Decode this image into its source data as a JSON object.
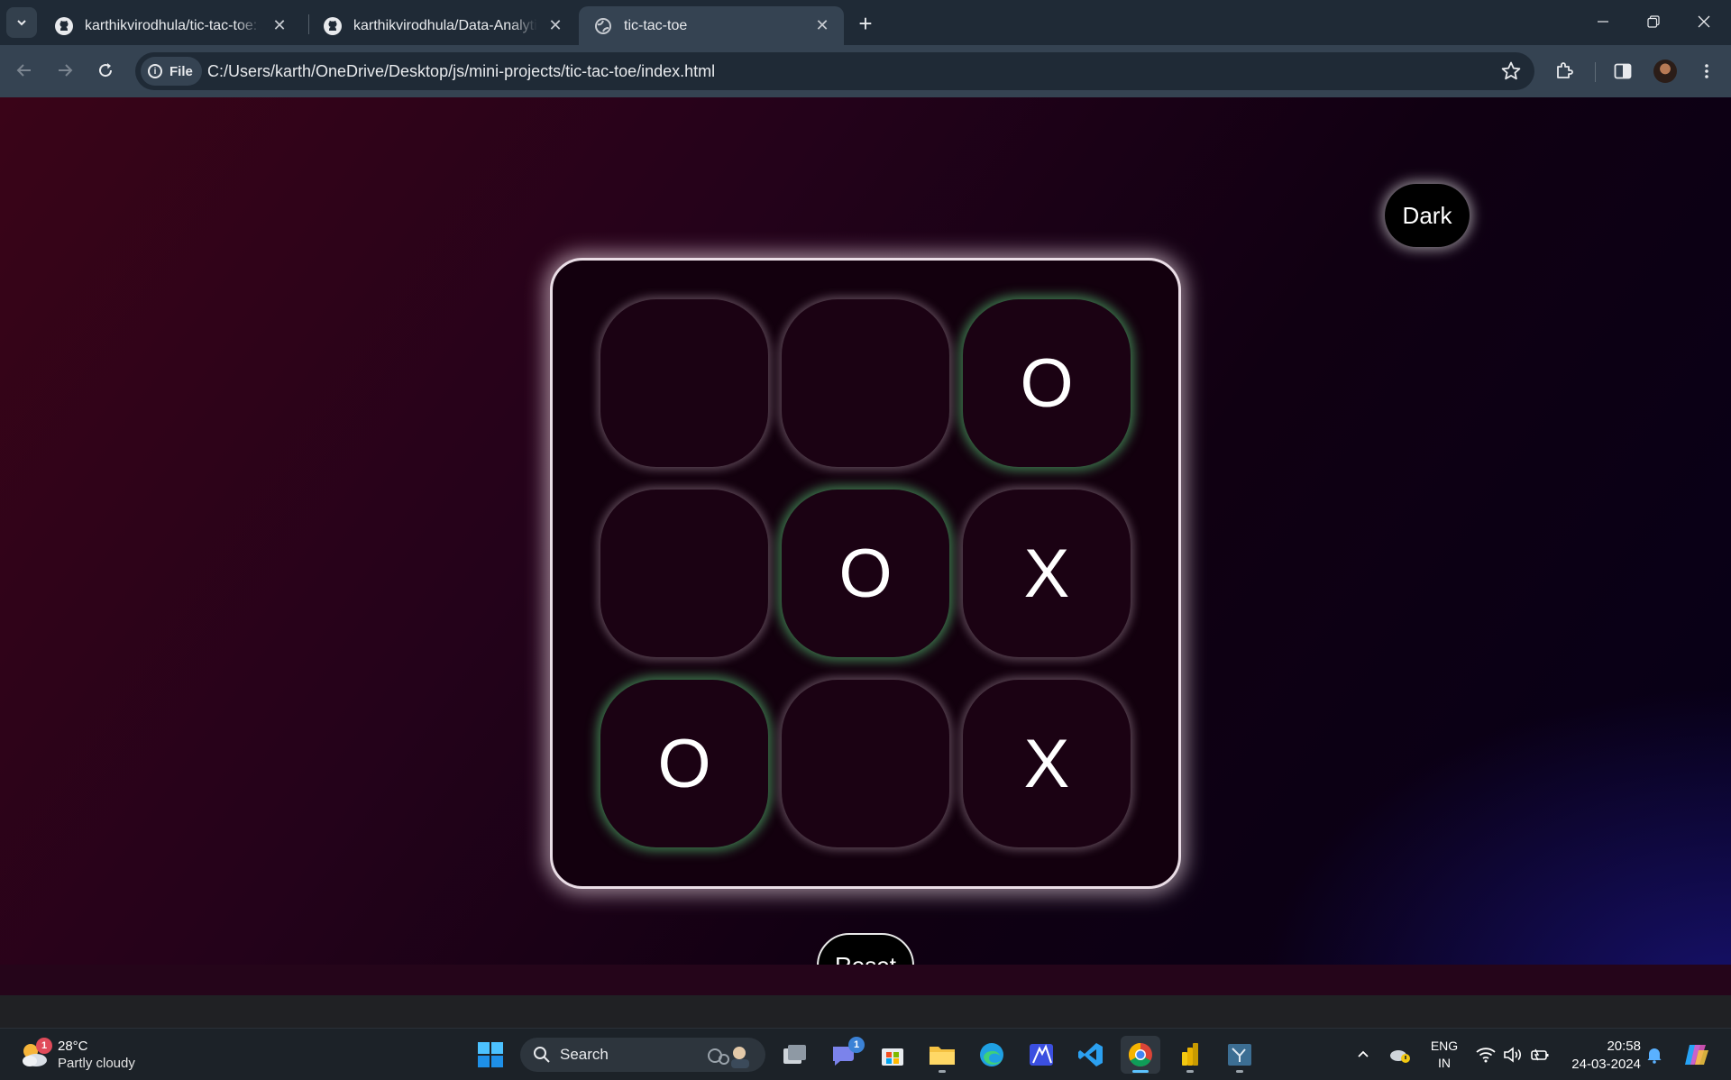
{
  "browser": {
    "tabs": [
      {
        "title": "karthikvirodhula/tic-tac-toe: A r",
        "favicon": "github-icon",
        "active": false
      },
      {
        "title": "karthikvirodhula/Data-Analytics",
        "favicon": "github-icon",
        "active": false
      },
      {
        "title": "tic-tac-toe",
        "favicon": "globe-icon",
        "active": true
      }
    ],
    "address": {
      "chip_label": "File",
      "url": "C:/Users/karth/OneDrive/Desktop/js/mini-projects/tic-tac-toe/index.html"
    }
  },
  "game": {
    "theme_button": "Dark",
    "reset_button": "Reset",
    "cells": [
      "",
      "",
      "O",
      "",
      "O",
      "X",
      "O",
      "",
      "X"
    ],
    "winning_cells": [
      2,
      4,
      6
    ],
    "colors": {
      "background_start": "#3a0418",
      "background_end": "#060018",
      "board": "#13000e",
      "cell": "#1b0213",
      "win_glow": "#5ac878"
    }
  },
  "taskbar": {
    "weather": {
      "temp": "28°C",
      "condition": "Partly cloudy",
      "badge": "1"
    },
    "search_placeholder": "Search",
    "chat_badge": "1",
    "apps": [
      "task-view",
      "teams",
      "store",
      "file-explorer",
      "edge",
      "app",
      "vscode",
      "chrome",
      "power-bi",
      "app"
    ],
    "language": {
      "line1": "ENG",
      "line2": "IN"
    },
    "clock": {
      "time": "20:58",
      "date": "24-03-2024"
    }
  }
}
